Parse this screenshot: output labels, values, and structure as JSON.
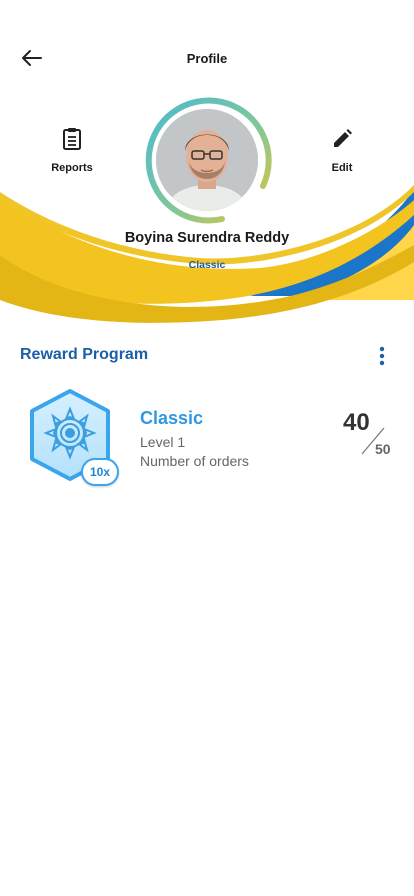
{
  "header": {
    "title": "Profile",
    "back_icon": "arrow-left-icon"
  },
  "actions": {
    "reports": {
      "label": "Reports",
      "icon": "clipboard-icon"
    },
    "edit": {
      "label": "Edit",
      "icon": "pencil-icon"
    }
  },
  "profile": {
    "name": "Boyina Surendra Reddy",
    "tier": "Classic"
  },
  "reward_program": {
    "title": "Reward Program",
    "menu_icon": "more-vertical-icon",
    "card": {
      "tier_name": "Classic",
      "level": "Level 1",
      "metric": "Number of orders",
      "multiplier": "10x",
      "current": "40",
      "target": "50",
      "badge_icon": "mandala-hexagon-icon"
    }
  },
  "colors": {
    "brand_yellow": "#f3c31f",
    "brand_blue": "#1b75c8",
    "title_blue": "#1d5fa6",
    "tier_blue": "#2f98e4",
    "ring_teal": "#4bbbd0",
    "ring_yellow": "#e2c53a"
  }
}
